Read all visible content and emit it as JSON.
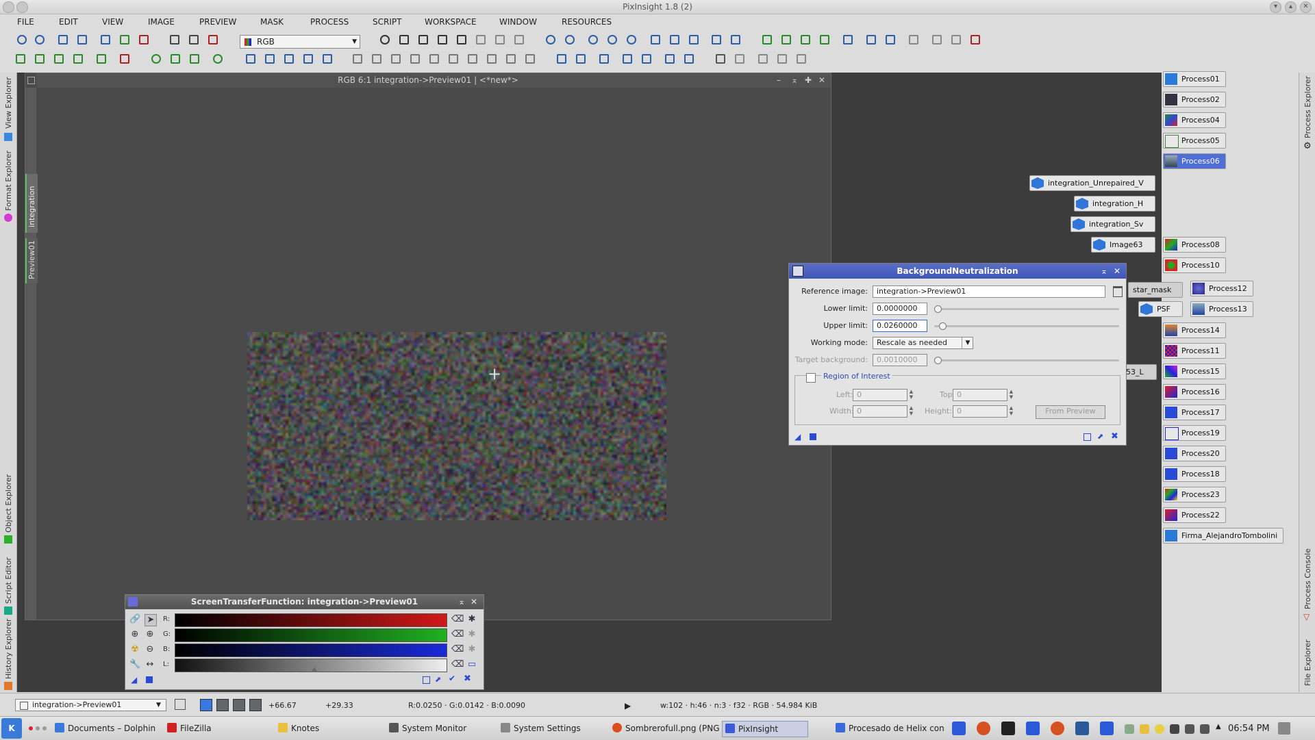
{
  "window": {
    "title": "PixInsight 1.8 (2)"
  },
  "menu": [
    "FILE",
    "EDIT",
    "VIEW",
    "IMAGE",
    "PREVIEW",
    "MASK",
    "PROCESS",
    "SCRIPT",
    "WORKSPACE",
    "WINDOW",
    "RESOURCES"
  ],
  "toolbar": {
    "channel_select": "RGB"
  },
  "left_dock": {
    "tabs": [
      "View Explorer",
      "Format Explorer",
      "Object Explorer",
      "Script Editor",
      "History Explorer"
    ]
  },
  "right_dock": {
    "tabs": [
      "Process Explorer",
      "Process Console",
      "File Explorer"
    ]
  },
  "image_window": {
    "title": "RGB 6:1 integration->Preview01 | <*new*>",
    "tabs": [
      "integration",
      "Preview01"
    ]
  },
  "process_icons": [
    "Process01",
    "Process02",
    "Process04",
    "Process05",
    "Process06",
    "Process08",
    "Process10",
    "Process12",
    "Process13",
    "Process14",
    "Process11",
    "Process15",
    "Process16",
    "Process17",
    "Process19",
    "Process20",
    "Process18",
    "Process23",
    "Process22",
    "Firma_AlejandroTombolini"
  ],
  "image_icons": [
    "integration_Unrepaired_V",
    "integration_H",
    "integration_Sv",
    "Image63",
    "star_mask",
    "PSF",
    "53_L"
  ],
  "bn_dialog": {
    "title": "BackgroundNeutralization",
    "reference_label": "Reference image:",
    "reference_value": "integration->Preview01",
    "lower_label": "Lower limit:",
    "lower_value": "0.0000000",
    "lower_level": 0.0,
    "upper_label": "Upper limit:",
    "upper_value": "0.0260000",
    "upper_level": 0.026,
    "mode_label": "Working mode:",
    "mode_value": "Rescale as needed",
    "target_label": "Target background:",
    "target_value": "0.0010000",
    "target_level": 0.001,
    "roi_label": "Region of Interest",
    "left_label": "Left:",
    "left_value": "0",
    "top_label": "Top:",
    "top_value": "0",
    "width_label": "Width:",
    "width_value": "0",
    "height_label": "Height:",
    "height_value": "0",
    "from_preview": "From Preview"
  },
  "stf_dialog": {
    "title": "ScreenTransferFunction: integration->Preview01",
    "channels": [
      "R:",
      "G:",
      "B:",
      "L:"
    ],
    "colors": {
      "r": "#d01818",
      "g": "#20b020",
      "b": "#1a2ad8"
    }
  },
  "status": {
    "view_select": "integration->Preview01",
    "x": "+66.67",
    "y": "+29.33",
    "pixel": "R:0.0250 · G:0.0142 · B:0.0090",
    "info": "w:102 · h:46 · n:3 · f32 · RGB · 54.984 KiB"
  },
  "taskbar": {
    "tasks": [
      "Documents – Dolphin",
      "FileZilla",
      "Knotes",
      "System Monitor",
      "System Settings",
      "Sombrerofull.png (PNG",
      "PixInsight",
      "Procesado de Helix con"
    ],
    "clock": "06:54 PM"
  }
}
